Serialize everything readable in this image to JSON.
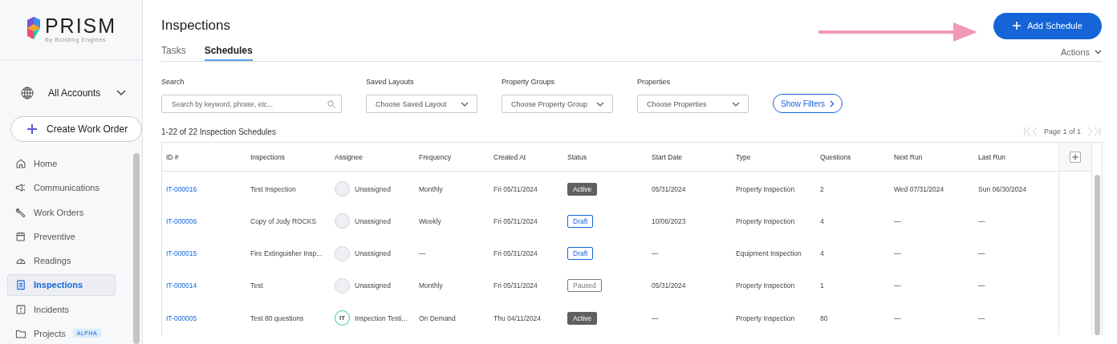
{
  "brand": {
    "name": "PRISM",
    "tagline": "By Building Engines"
  },
  "account_selector": {
    "label": "All Accounts"
  },
  "create_button": {
    "label": "Create Work Order"
  },
  "nav": [
    {
      "label": "Home",
      "selected": false
    },
    {
      "label": "Communications",
      "selected": false
    },
    {
      "label": "Work Orders",
      "selected": false
    },
    {
      "label": "Preventive",
      "selected": false
    },
    {
      "label": "Readings",
      "selected": false
    },
    {
      "label": "Inspections",
      "selected": true
    },
    {
      "label": "Incidents",
      "selected": false
    },
    {
      "label": "Projects",
      "selected": false,
      "badge": "ALPHA"
    }
  ],
  "page_title": "Inspections",
  "add_button": {
    "label": "Add Schedule"
  },
  "tabs": [
    {
      "label": "Tasks",
      "selected": false
    },
    {
      "label": "Schedules",
      "selected": true
    }
  ],
  "actions": {
    "label": "Actions"
  },
  "filters": {
    "search": {
      "label": "Search",
      "placeholder": "Search by keyword, phrase, etc..."
    },
    "dropdowns": [
      {
        "label": "Saved Layouts",
        "placeholder": "Choose Saved Layout"
      },
      {
        "label": "Property Groups",
        "placeholder": "Choose Property Group"
      },
      {
        "label": "Properties",
        "placeholder": "Choose Properties"
      }
    ],
    "show_filters": "Show Filters"
  },
  "summary": "1-22 of 22 Inspection Schedules",
  "pagination": "Page 1 of 1",
  "table": {
    "columns": [
      "ID #",
      "Inspections",
      "Assignee",
      "Frequency",
      "Created At",
      "Status",
      "Start Date",
      "Type",
      "Questions",
      "Next Run",
      "Last Run"
    ],
    "rows": [
      {
        "id": "IT-000016",
        "inspection": "Test Inspection",
        "assignee": {
          "name": "Unassigned"
        },
        "frequency": "Monthly",
        "created_at": "Fri 05/31/2024",
        "status": {
          "label": "Active",
          "kind": "active"
        },
        "start_date": "05/31/2024",
        "type": "Property Inspection",
        "questions": "2",
        "next_run": "Wed 07/31/2024",
        "last_run": "Sun 06/30/2024"
      },
      {
        "id": "IT-000006",
        "inspection": "Copy of Jody ROCKS",
        "assignee": {
          "name": "Unassigned"
        },
        "frequency": "Weekly",
        "created_at": "Fri 05/31/2024",
        "status": {
          "label": "Draft",
          "kind": "draft"
        },
        "start_date": "10/06/2023",
        "type": "Property Inspection",
        "questions": "4",
        "next_run": "—",
        "last_run": "—"
      },
      {
        "id": "IT-000015",
        "inspection": "Fire Extinguisher Insp...",
        "assignee": {
          "name": "Unassigned"
        },
        "frequency": "—",
        "created_at": "Fri 05/31/2024",
        "status": {
          "label": "Draft",
          "kind": "draft"
        },
        "start_date": "—",
        "type": "Equipment Inspection",
        "questions": "4",
        "next_run": "—",
        "last_run": "—"
      },
      {
        "id": "IT-000014",
        "inspection": "Test",
        "assignee": {
          "name": "Unassigned"
        },
        "frequency": "Monthly",
        "created_at": "Fri 05/31/2024",
        "status": {
          "label": "Paused",
          "kind": "paused"
        },
        "start_date": "05/31/2024",
        "type": "Property Inspection",
        "questions": "1",
        "next_run": "—",
        "last_run": "—"
      },
      {
        "id": "IT-000005",
        "inspection": "Test 80 questions",
        "assignee": {
          "initials": "IT",
          "name": "Inspection Testi..."
        },
        "frequency": "On Demand",
        "created_at": "Thu 04/11/2024",
        "status": {
          "label": "Active",
          "kind": "active"
        },
        "start_date": "—",
        "type": "Property Inspection",
        "questions": "80",
        "next_run": "—",
        "last_run": "—"
      }
    ]
  }
}
